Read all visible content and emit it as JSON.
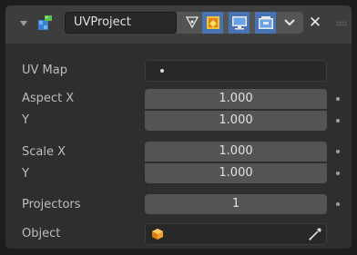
{
  "header": {
    "modifier_name": "UVProject",
    "toggles": [
      "edit-mode-icon",
      "cage-icon",
      "realtime-icon",
      "render-icon",
      "dropdown-chevron-icon"
    ]
  },
  "properties": {
    "uv_map": {
      "label": "UV Map",
      "value": ""
    },
    "aspect_x": {
      "label": "Aspect X",
      "value": "1.000"
    },
    "aspect_y": {
      "label": "Y",
      "value": "1.000"
    },
    "scale_x": {
      "label": "Scale X",
      "value": "1.000"
    },
    "scale_y": {
      "label": "Y",
      "value": "1.000"
    },
    "projectors": {
      "label": "Projectors",
      "value": "1"
    },
    "object": {
      "label": "Object",
      "value": ""
    }
  },
  "colors": {
    "panel": "#2e2e2e",
    "header": "#3d3d3d",
    "field": "#545454",
    "active_toggle": "#4772b3",
    "object_icon": "#f2a02c"
  }
}
